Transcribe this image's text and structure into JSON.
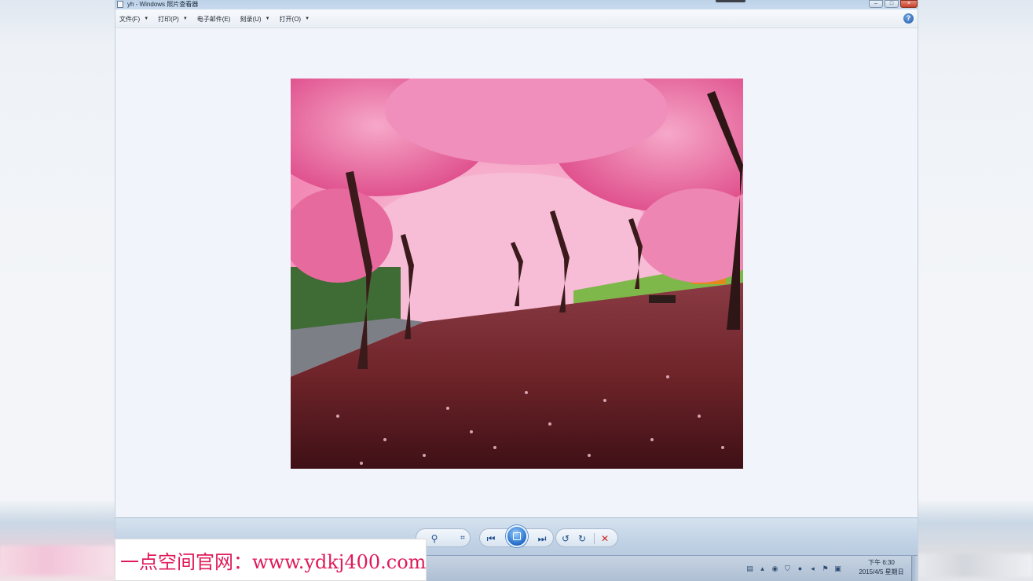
{
  "window": {
    "title": "yh - Windows 照片查看器",
    "controls": {
      "minimize": "–",
      "maximize": "□",
      "close": "×"
    }
  },
  "menu": {
    "items": [
      {
        "label": "文件(F)"
      },
      {
        "label": "打印(P)"
      },
      {
        "label": "电子邮件(E)"
      },
      {
        "label": "刻录(U)"
      },
      {
        "label": "打开(O)"
      }
    ],
    "arrow": "▼",
    "help": "?"
  },
  "toolbar": {
    "zoom_icon": "⚲",
    "fit_icon": "⌗",
    "prev_icon": "⏮",
    "next_icon": "⏭",
    "rotate_ccw_icon": "↺",
    "rotate_cw_icon": "↻",
    "delete_icon": "✕"
  },
  "taskbar": {
    "clock_time": "下午 6:30",
    "clock_date": "2015/4/5 星期日"
  },
  "watermark": {
    "text": "一点空间官网：www.ydkj400.com"
  }
}
